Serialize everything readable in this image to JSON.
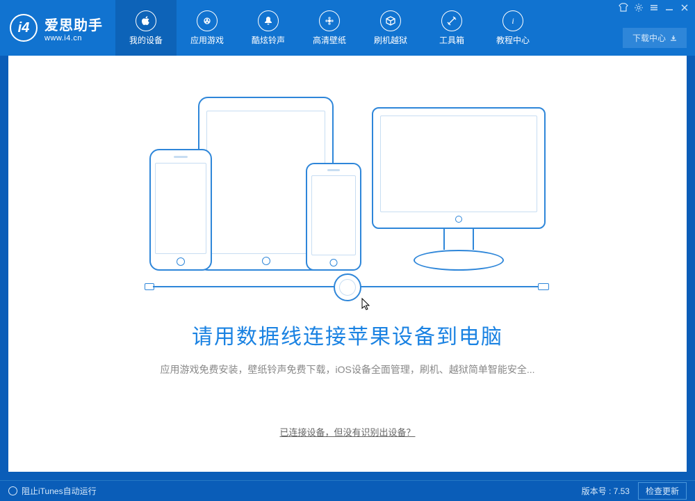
{
  "app": {
    "title": "爱思助手",
    "subtitle": "www.i4.cn"
  },
  "nav": {
    "items": [
      {
        "label": "我的设备"
      },
      {
        "label": "应用游戏"
      },
      {
        "label": "酷炫铃声"
      },
      {
        "label": "高清壁纸"
      },
      {
        "label": "刷机越狱"
      },
      {
        "label": "工具箱"
      },
      {
        "label": "教程中心"
      }
    ]
  },
  "download_center": "下载中心",
  "content": {
    "main_title": "请用数据线连接苹果设备到电脑",
    "sub_title": "应用游戏免费安装，壁纸铃声免费下载，iOS设备全面管理，刷机、越狱简单智能安全...",
    "help_link": "已连接设备，但没有识别出设备？"
  },
  "footer": {
    "block_itunes": "阻止iTunes自动运行",
    "version_label": "版本号 : 7.53",
    "update_btn": "检查更新"
  }
}
